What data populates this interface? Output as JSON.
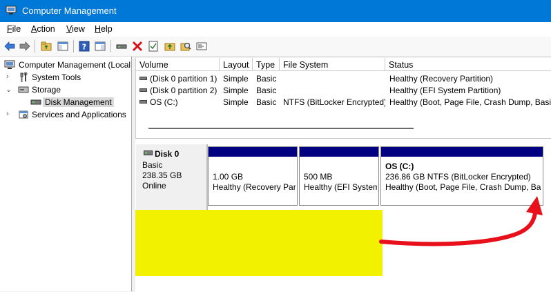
{
  "window": {
    "title": "Computer Management"
  },
  "menu": [
    {
      "label_u": "F",
      "label_rest": "ile"
    },
    {
      "label_u": "A",
      "label_rest": "ction"
    },
    {
      "label_u": "V",
      "label_rest": "iew"
    },
    {
      "label_u": "H",
      "label_rest": "elp"
    }
  ],
  "toolbar": {
    "icons": [
      "back-icon",
      "forward-icon",
      "up-folder-icon",
      "show-hide-tree-icon",
      "help-icon",
      "show-hide-action-pane-icon",
      "connect-drive-icon",
      "delete-icon",
      "properties-icon",
      "folder-up-icon",
      "search-icon",
      "settings-panel-icon"
    ]
  },
  "tree": {
    "items": [
      {
        "label": "Computer Management (Local"
      },
      {
        "label": "System Tools"
      },
      {
        "label": "Storage"
      },
      {
        "label": "Disk Management"
      },
      {
        "label": "Services and Applications"
      }
    ]
  },
  "volumes": {
    "columns": [
      "Volume",
      "Layout",
      "Type",
      "File System",
      "Status"
    ],
    "rows": [
      {
        "volume": "(Disk 0 partition 1)",
        "layout": "Simple",
        "type": "Basic",
        "fs": "",
        "status": "Healthy (Recovery Partition)"
      },
      {
        "volume": "(Disk 0 partition 2)",
        "layout": "Simple",
        "type": "Basic",
        "fs": "",
        "status": "Healthy (EFI System Partition)"
      },
      {
        "volume": "OS (C:)",
        "layout": "Simple",
        "type": "Basic",
        "fs": "NTFS (BitLocker Encrypted)",
        "status": "Healthy (Boot, Page File, Crash Dump, Basi"
      }
    ]
  },
  "disk": {
    "name": "Disk 0",
    "type": "Basic",
    "size": "238.35 GB",
    "state": "Online",
    "partitions": [
      {
        "size": "1.00 GB",
        "status": "Healthy (Recovery Par"
      },
      {
        "size": "500 MB",
        "status": "Healthy (EFI System"
      },
      {
        "name": "OS  (C:)",
        "size": "236.86 GB NTFS (BitLocker Encrypted)",
        "status": "Healthy (Boot, Page File, Crash Dump, Bas"
      }
    ]
  },
  "colors": {
    "titlebar": "#0078d7",
    "partition_bar": "#000080",
    "highlight": "#f2f200",
    "arrow": "#e8101a"
  }
}
